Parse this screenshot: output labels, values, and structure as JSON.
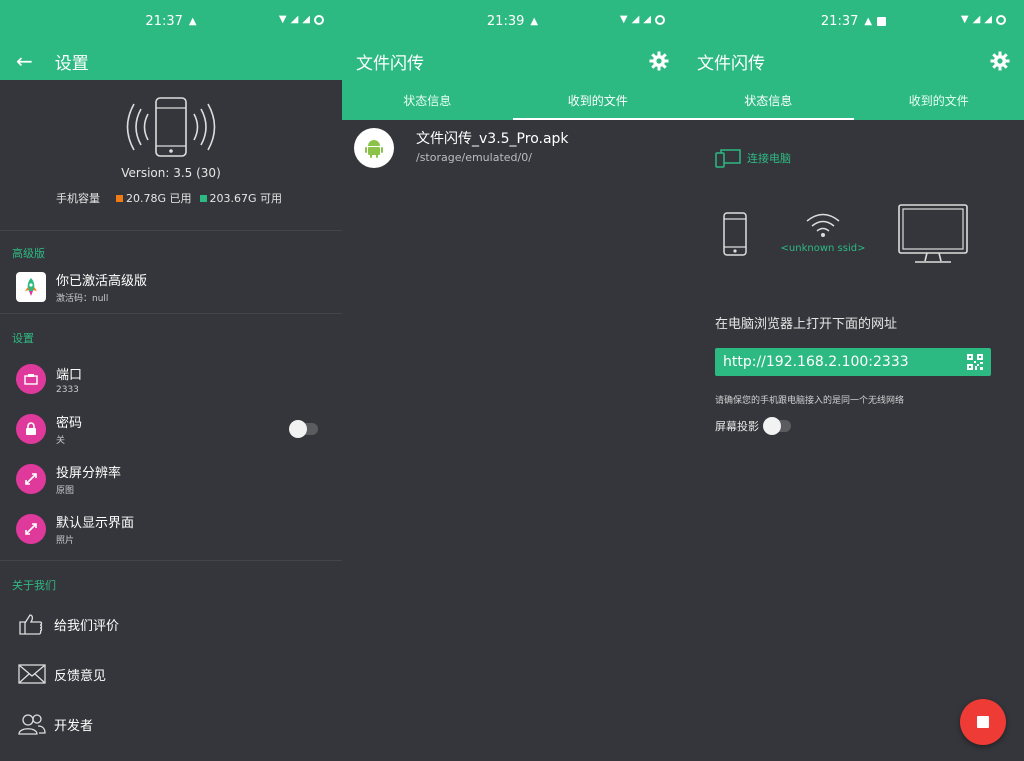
{
  "colors": {
    "accent": "#2dba82",
    "background": "#35363b",
    "pink_icon": "#e0399c",
    "stop_red": "#ee3b36",
    "used_orange": "#f07b13",
    "free_green": "#2dba82"
  },
  "settings_screen": {
    "status_time": "21:37",
    "title": "设置",
    "version": "Version: 3.5 (30)",
    "capacity_label": "手机容量",
    "used": "20.78G 已用",
    "free": "203.67G 可用",
    "premium_section": "高级版",
    "premium_title": "你已激活高级版",
    "premium_sub": "激活码：null",
    "settings_section": "设置",
    "items": [
      {
        "title": "端口",
        "sub": "2333",
        "icon": "ethernet-port-icon"
      },
      {
        "title": "密码",
        "sub": "关",
        "icon": "lock-icon"
      },
      {
        "title": "投屏分辨率",
        "sub": "原图",
        "icon": "resize-icon"
      },
      {
        "title": "默认显示界面",
        "sub": "照片",
        "icon": "resize-icon"
      }
    ],
    "about_section": "关于我们",
    "about_items": [
      {
        "title": "给我们评价",
        "icon": "thumbs-up-icon"
      },
      {
        "title": "反馈意见",
        "icon": "envelope-icon"
      },
      {
        "title": "开发者",
        "icon": "people-icon"
      }
    ]
  },
  "files_screen": {
    "status_time": "21:39",
    "title": "文件闪传",
    "tabs": [
      "状态信息",
      "收到的文件"
    ],
    "active_tab": 1,
    "file": {
      "name": "文件闪传_v3.5_Pro.apk",
      "path": "/storage/emulated/0/"
    }
  },
  "status_screen": {
    "status_time": "21:37",
    "title": "文件闪传",
    "tabs": [
      "状态信息",
      "收到的文件"
    ],
    "active_tab": 0,
    "connect_label": "连接电脑",
    "ssid": "<unknown ssid>",
    "instruction": "在电脑浏览器上打开下面的网址",
    "url": "http://192.168.2.100:2333",
    "note": "请确保您的手机跟电脑接入的是同一个无线网络",
    "screencast_label": "屏幕投影"
  }
}
